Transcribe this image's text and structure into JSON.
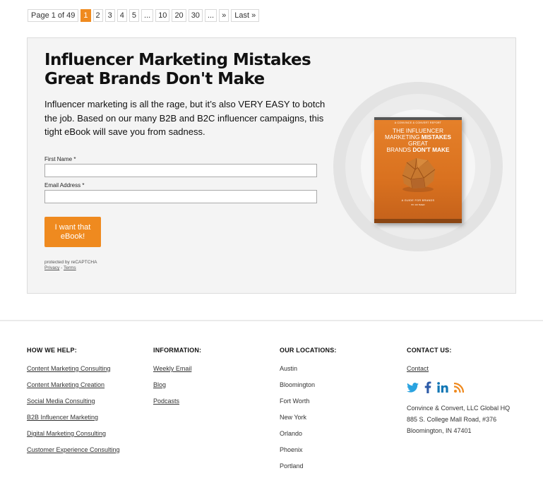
{
  "pagination": {
    "info": "Page 1 of 49",
    "items": [
      "1",
      "2",
      "3",
      "4",
      "5",
      "...",
      "10",
      "20",
      "30",
      "...",
      "»",
      "Last »"
    ],
    "current": "1"
  },
  "optin": {
    "title": "Influencer Marketing Mistakes Great Brands Don't Make",
    "description": "Influencer marketing is all the rage, but it’s also VERY EASY to botch the job. Based on our many B2B and B2C influencer campaigns, this tight eBook will save you from sadness.",
    "first_name_label": "First Name *",
    "first_name_value": "",
    "email_label": "Email Address *",
    "email_value": "",
    "button_label": "I want that eBook!",
    "recaptcha_text": "protected by reCAPTCHA",
    "privacy_label": "Privacy",
    "separator": " - ",
    "terms_label": "Terms"
  },
  "book": {
    "kicker": "A CONVINCE & CONVERT REPORT",
    "title_line1": "THE INFLUENCER",
    "title_line2a": "MARKETING ",
    "title_line2b": "MISTAKES",
    "title_line2c": " GREAT",
    "title_line3a": "BRANDS ",
    "title_line3b": "DON'T MAKE",
    "guide": "A GUIDE FOR BRANDS",
    "author": "BY JAY BAER"
  },
  "footer": {
    "how_we_help": {
      "heading": "HOW WE HELP:",
      "links": [
        "Content Marketing Consulting",
        "Content Marketing Creation",
        "Social Media Consulting",
        "B2B Influencer Marketing",
        "Digital Marketing Consulting",
        "Customer Experience Consulting"
      ]
    },
    "information": {
      "heading": "INFORMATION:",
      "links": [
        "Weekly Email",
        "Blog",
        "Podcasts"
      ]
    },
    "locations": {
      "heading": "OUR LOCATIONS:",
      "items": [
        "Austin",
        "Bloomington",
        "Fort Worth",
        "New York",
        "Orlando",
        "Phoenix",
        "Portland"
      ]
    },
    "contact": {
      "heading": "CONTACT US:",
      "link": "Contact",
      "social_icons": [
        "twitter-icon",
        "facebook-icon",
        "linkedin-icon",
        "rss-icon"
      ],
      "address_line1": "Convince & Convert, LLC Global HQ",
      "address_line2": "885 S. College Mall Road, #376",
      "address_line3": "Bloomington, IN 47401"
    }
  },
  "colors": {
    "accent": "#ef8a1f",
    "twitter": "#2aa3e0",
    "facebook": "#2d5ba8",
    "linkedin": "#1277b5",
    "rss": "#ef8a1f"
  }
}
